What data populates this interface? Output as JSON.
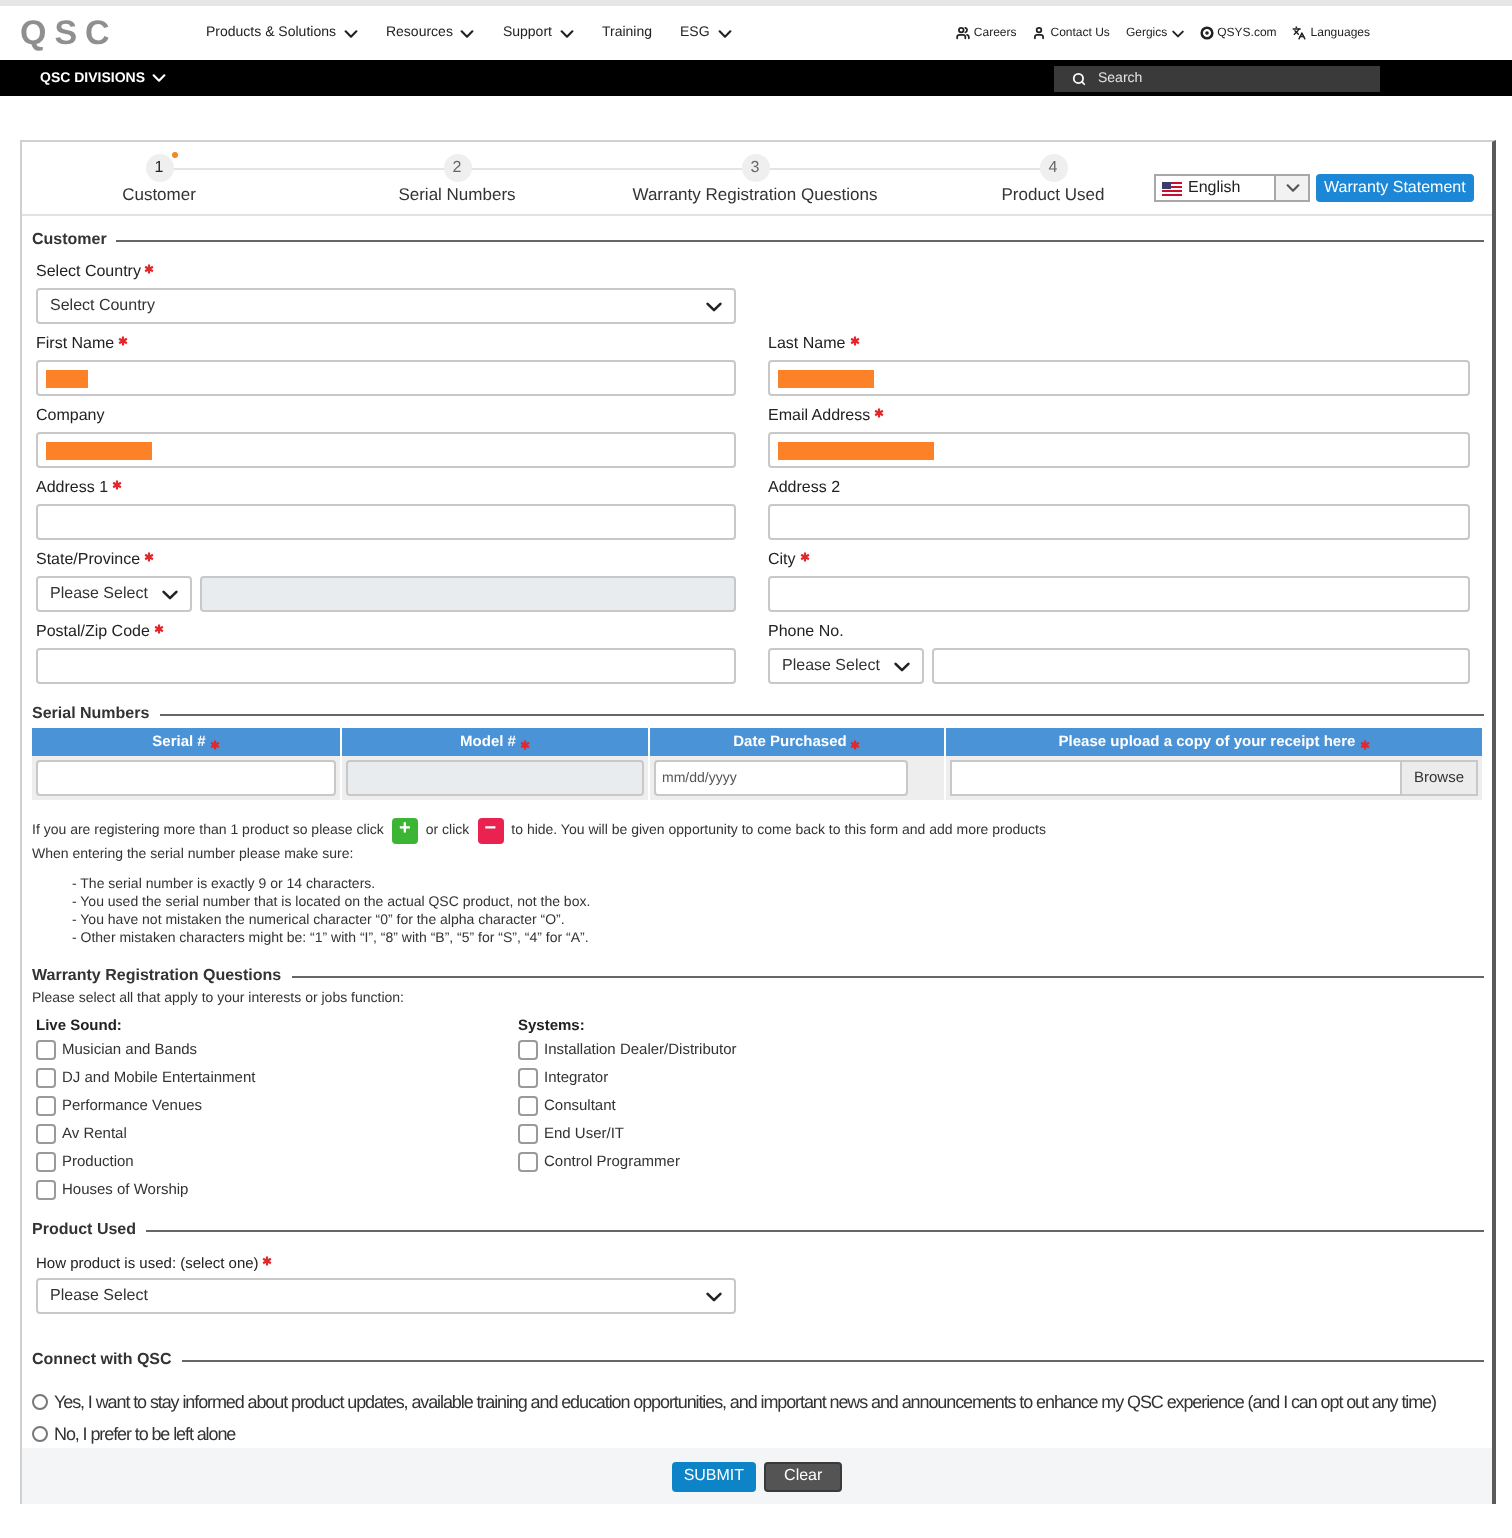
{
  "header": {
    "logo": "QSC",
    "nav": [
      {
        "label": "Products & Solutions",
        "dropdown": true
      },
      {
        "label": "Resources",
        "dropdown": true
      },
      {
        "label": "Support",
        "dropdown": true
      },
      {
        "label": "Training",
        "dropdown": false
      },
      {
        "label": "ESG",
        "dropdown": true
      }
    ],
    "links": [
      {
        "label": "Careers",
        "kind": "people"
      },
      {
        "label": "Contact Us",
        "kind": "person"
      },
      {
        "label": "Gergics",
        "kind": "menu"
      },
      {
        "label": "QSYS.com",
        "kind": "site"
      },
      {
        "label": "Languages",
        "kind": "language"
      }
    ]
  },
  "divisions_bar": {
    "label": "QSC DIVISIONS",
    "search": {
      "placeholder": "Search"
    }
  },
  "steps": [
    {
      "number": "1",
      "label": "Customer",
      "selected": true
    },
    {
      "number": "2",
      "label": "Serial Numbers",
      "selected": false
    },
    {
      "number": "3",
      "label": "Warranty Registration Questions",
      "selected": false
    },
    {
      "number": "4",
      "label": "Product Used",
      "selected": false
    }
  ],
  "language_select": {
    "value": "English"
  },
  "warranty_button": "Warranty Statement",
  "customer": {
    "title": "Customer",
    "rows": [
      [
        {
          "label": "Select Country",
          "required": true,
          "kind": "select",
          "value": "Select Country"
        }
      ],
      [
        {
          "label": "First Name",
          "required": true,
          "kind": "text",
          "redacted": true
        },
        {
          "label": "Last Name",
          "required": true,
          "kind": "text",
          "redacted": true
        }
      ],
      [
        {
          "label": "Company",
          "required": false,
          "kind": "text",
          "redacted": true
        },
        {
          "label": "Email Address",
          "required": true,
          "kind": "text",
          "redacted": true
        }
      ],
      [
        {
          "label": "Address 1",
          "required": true,
          "kind": "text",
          "redacted": false
        },
        {
          "label": "Address 2",
          "required": false,
          "kind": "text",
          "redacted": false
        }
      ],
      [
        {
          "label": "State/Province",
          "required": true,
          "kind": "select_with_input",
          "value": "Please Select",
          "secondary_disabled": true
        },
        {
          "label": "City",
          "required": true,
          "kind": "text",
          "redacted": false
        }
      ],
      [
        {
          "label": "Postal/Zip Code",
          "required": true,
          "kind": "text",
          "redacted": false
        },
        {
          "label": "Phone No.",
          "required": false,
          "kind": "select_with_input",
          "value": "Please Select",
          "secondary_disabled": false
        }
      ]
    ]
  },
  "serial_numbers": {
    "title": "Serial Numbers",
    "columns": [
      {
        "label": "Serial #",
        "required": true
      },
      {
        "label": "Model #",
        "required": true
      },
      {
        "label": "Date Purchased",
        "required": true
      },
      {
        "label": "Please upload a copy of your receipt here",
        "required": true
      }
    ],
    "row": [
      {
        "kind": "text",
        "disabled": false
      },
      {
        "kind": "text",
        "disabled": true
      },
      {
        "kind": "date",
        "placeholder": "mm/dd/yyyy"
      },
      {
        "kind": "file",
        "button": "Browse"
      }
    ]
  },
  "instructions": {
    "add_line": {
      "before": "If you are registering more than 1 product so please click",
      "add_button": "+",
      "middle": "or click",
      "remove_button": "−",
      "after": "to hide. You will be given opportunity to come back to this form and add more products"
    },
    "checklist_intro": "When entering the serial number please make sure:",
    "checklist": [
      "- The serial number is exactly 9 or 14 characters.",
      "- You used the serial number that is located on the actual QSC product, not the box.",
      "- You have not mistaken the numerical character “0” for the alpha character “O”.",
      "- Other mistaken characters might be: “1” with “I”, “8” with “B”, “5” for “S”, “4” for “A”."
    ]
  },
  "questions": {
    "title": "Warranty Registration Questions",
    "intro": "Please select all that apply to your interests or jobs function:",
    "groups": [
      {
        "title": "Live Sound:",
        "options": [
          {
            "label": "Musician and Bands",
            "checked": false
          },
          {
            "label": "DJ and Mobile Entertainment",
            "checked": false
          },
          {
            "label": "Performance Venues",
            "checked": false
          },
          {
            "label": "Av Rental",
            "checked": false
          },
          {
            "label": "Production",
            "checked": false
          },
          {
            "label": "Houses of Worship",
            "checked": false
          }
        ]
      },
      {
        "title": "Systems:",
        "options": [
          {
            "label": "Installation Dealer/Distributor",
            "checked": false
          },
          {
            "label": "Integrator",
            "checked": false
          },
          {
            "label": "Consultant",
            "checked": false
          },
          {
            "label": "End User/IT",
            "checked": false
          },
          {
            "label": "Control Programmer",
            "checked": false
          }
        ]
      }
    ]
  },
  "product_used": {
    "title": "Product Used",
    "label": "How product is used: (select one)",
    "required": true,
    "select": {
      "value": "Please Select"
    }
  },
  "connect": {
    "title": "Connect with QSC",
    "options": [
      {
        "label": "Yes, I want to stay informed about product updates, available training and education opportunities, and important news and announcements to enhance my QSC experience (and I can opt out any time)",
        "selected": false
      },
      {
        "label": "No, I prefer to be left alone",
        "selected": false
      }
    ]
  },
  "footer": {
    "buttons": [
      {
        "label": "SUBMIT",
        "kind": "primary"
      },
      {
        "label": "Clear",
        "kind": "secondary"
      }
    ]
  }
}
